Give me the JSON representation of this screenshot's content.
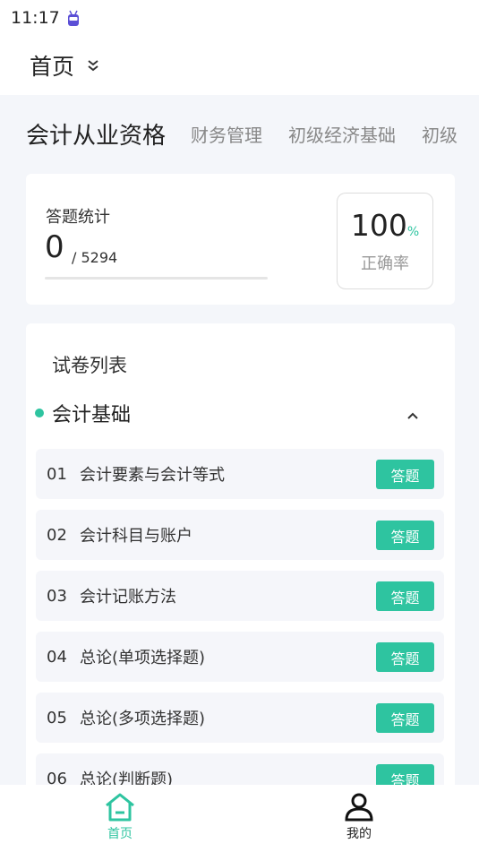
{
  "status_bar": {
    "time": "11:17"
  },
  "header": {
    "title": "首页"
  },
  "category_tabs": [
    "会计从业资格",
    "财务管理",
    "初级经济基础",
    "初级"
  ],
  "stats": {
    "label": "答题统计",
    "answered": "0",
    "total": "/ 5294",
    "accuracy_value": "100",
    "accuracy_unit": "%",
    "accuracy_label": "正确率"
  },
  "paper_list": {
    "title": "试卷列表",
    "section_title": "会计基础",
    "items": [
      {
        "num": "01",
        "title": "会计要素与会计等式",
        "button": "答题"
      },
      {
        "num": "02",
        "title": "会计科目与账户",
        "button": "答题"
      },
      {
        "num": "03",
        "title": "会计记账方法",
        "button": "答题"
      },
      {
        "num": "04",
        "title": "总论(单项选择题)",
        "button": "答题"
      },
      {
        "num": "05",
        "title": "总论(多项选择题)",
        "button": "答题"
      },
      {
        "num": "06",
        "title": "总论(判断题)",
        "button": "答题"
      }
    ]
  },
  "tab_bar": {
    "home_label": "首页",
    "mine_label": "我的"
  },
  "colors": {
    "accent": "#2ec4a0",
    "background": "#f4f6fa"
  }
}
